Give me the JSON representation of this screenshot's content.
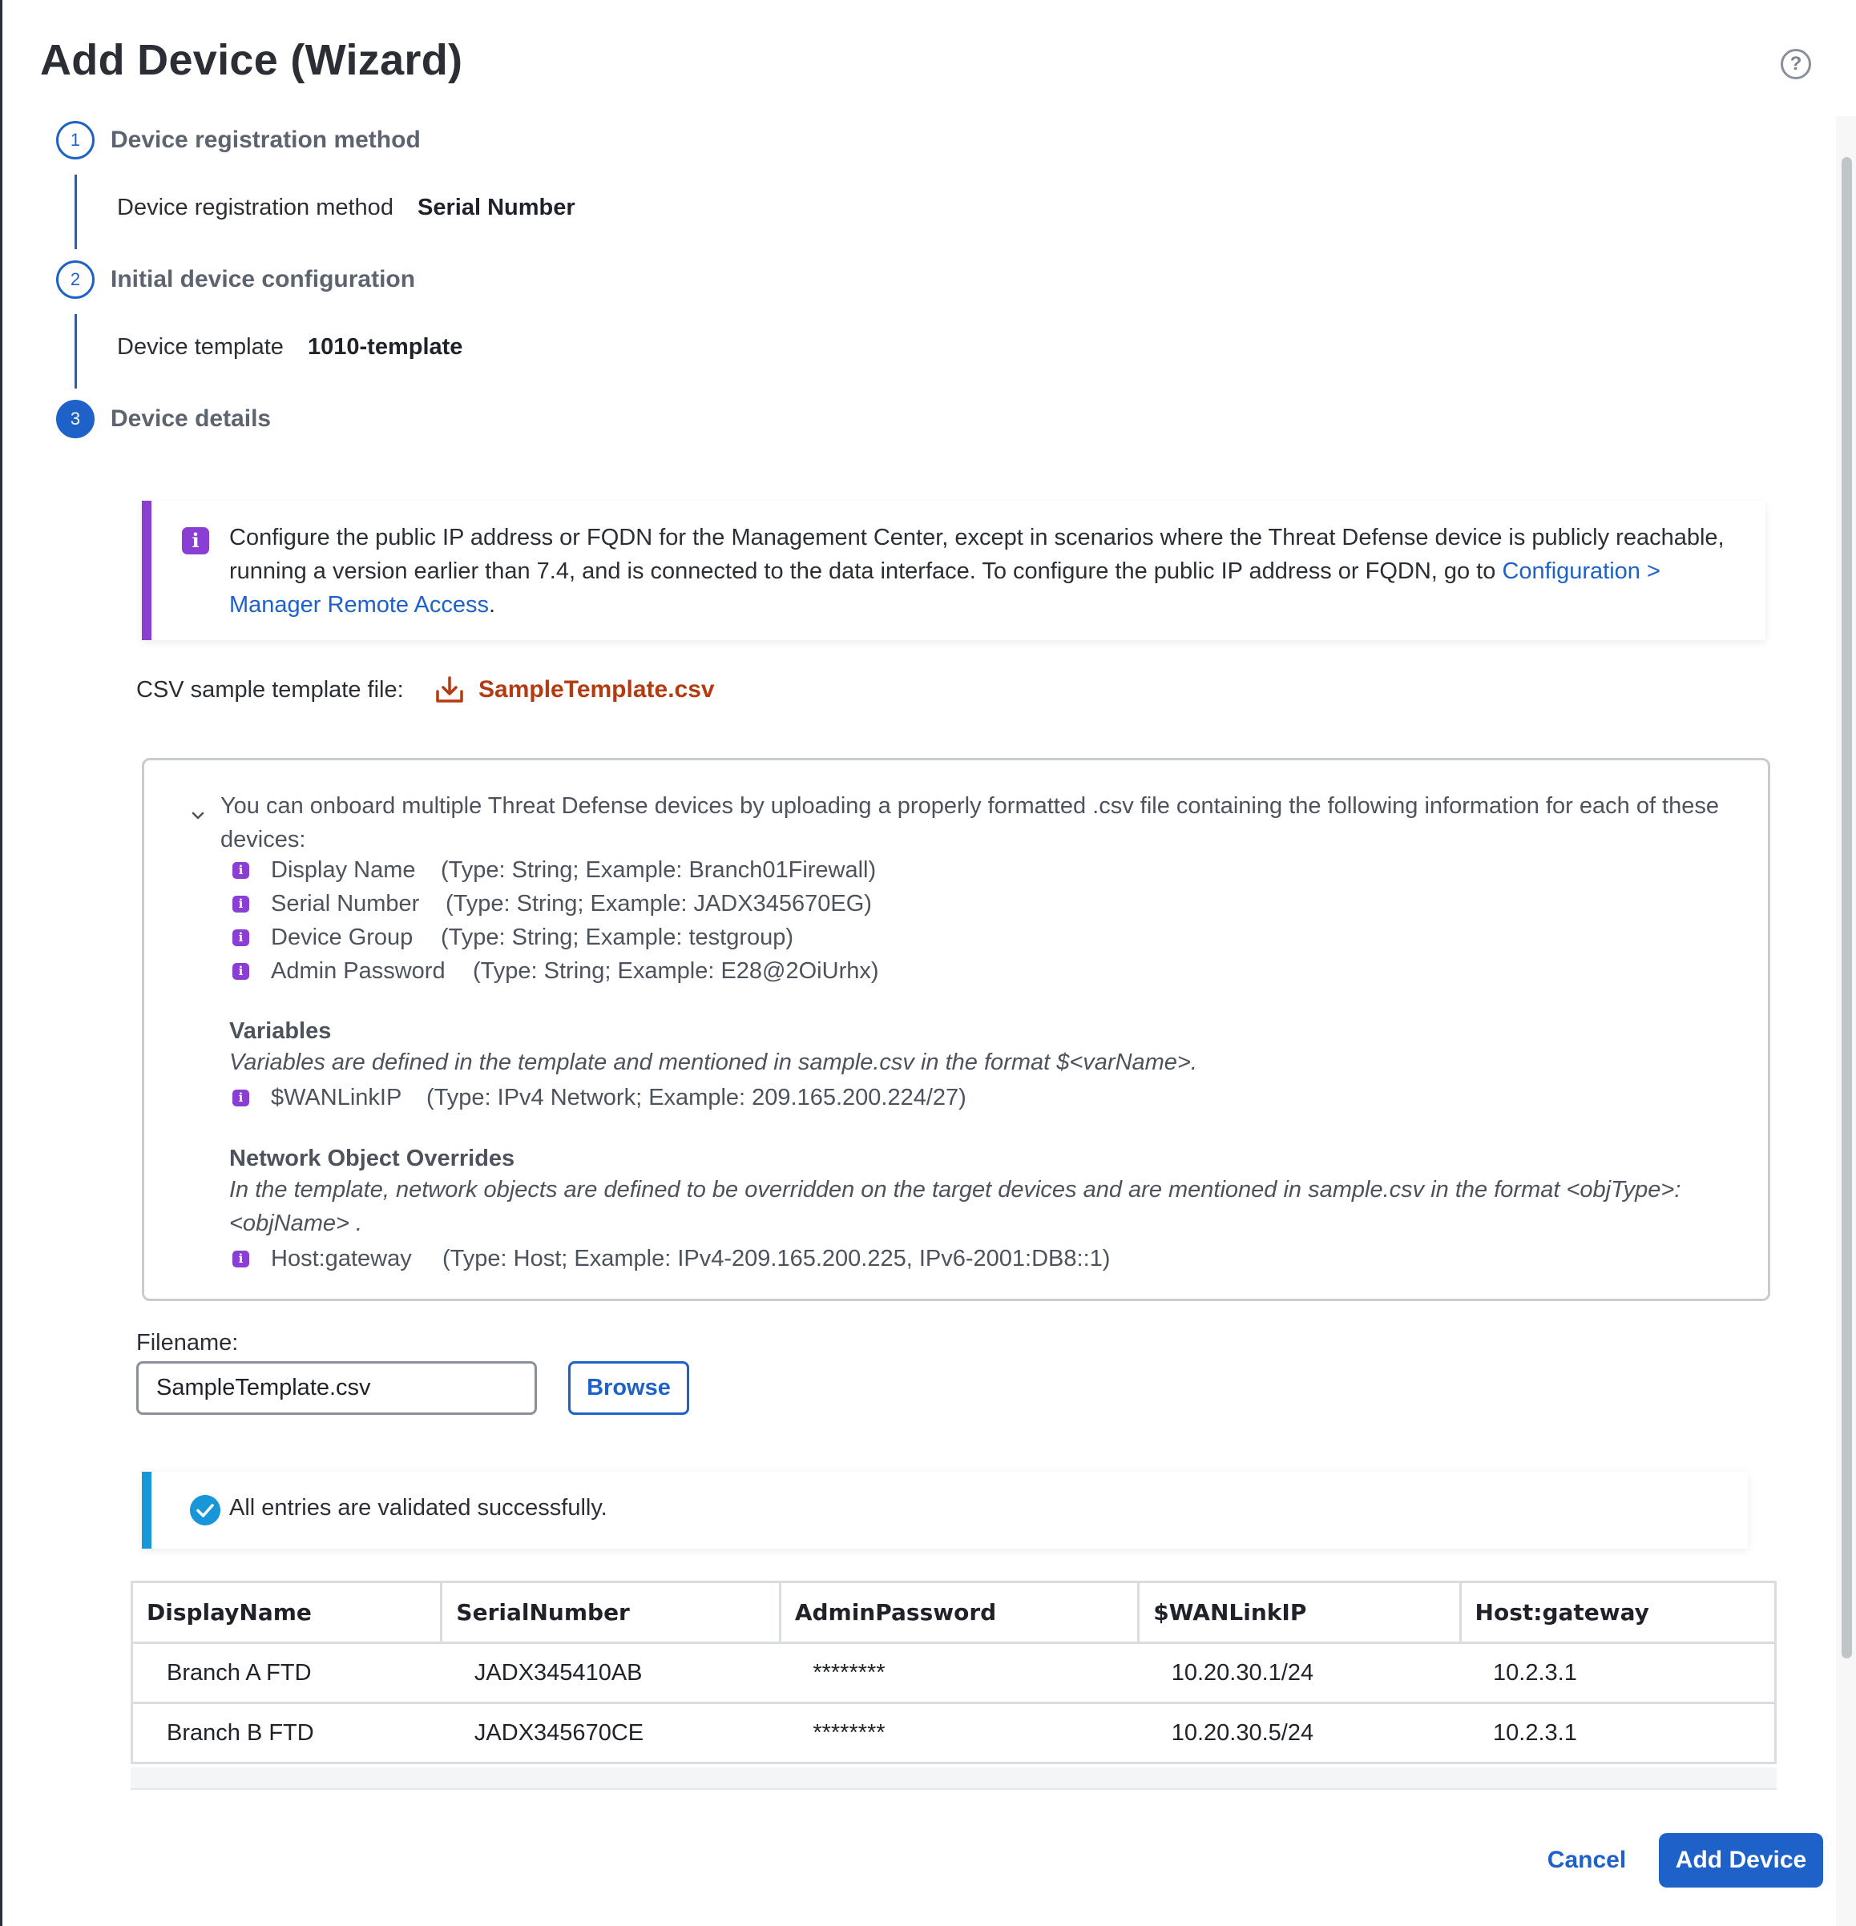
{
  "dialog": {
    "title": "Add Device (Wizard)"
  },
  "steps": [
    {
      "number": "1",
      "label": "Device registration method",
      "summary_key": "Device registration method",
      "summary_value": "Serial Number"
    },
    {
      "number": "2",
      "label": "Initial device configuration",
      "summary_key": "Device template",
      "summary_value": "1010-template"
    },
    {
      "number": "3",
      "label": "Device details"
    }
  ],
  "info_callout": {
    "text": "Configure the public IP address or FQDN for the Management Center, except in scenarios where the Threat Defense device is publicly reachable, running a version earlier than 7.4, and is connected to the data interface. To configure the public IP address or FQDN, go to",
    "link": "Configuration > Manager Remote Access",
    "suffix": "."
  },
  "csv_sample": {
    "label": "CSV sample template file:",
    "file": "SampleTemplate.csv"
  },
  "info_panel": {
    "intro": "You can onboard multiple Threat Defense devices by uploading a properly formatted .csv file containing the following information for each of these devices:",
    "fields": [
      {
        "name": "Display Name",
        "detail": "(Type: String; Example: Branch01Firewall)"
      },
      {
        "name": "Serial Number",
        "detail": "(Type: String; Example: JADX345670EG)"
      },
      {
        "name": "Device Group",
        "detail": "(Type: String; Example: testgroup)"
      },
      {
        "name": "Admin Password",
        "detail": "(Type: String; Example: E28@2OiUrhx)"
      }
    ],
    "variables": {
      "heading": "Variables",
      "note": "Variables are defined in the template and mentioned in sample.csv in the format $<varName>.",
      "items": [
        {
          "name": "$WANLinkIP",
          "detail": "(Type: IPv4 Network; Example: 209.165.200.224/27)"
        }
      ]
    },
    "overrides": {
      "heading": "Network Object Overrides",
      "note": "In the template, network objects are defined to be overridden on the target devices and are mentioned in sample.csv in the format <objType>:<objName> .",
      "items": [
        {
          "name": "Host:gateway",
          "detail": "(Type: Host; Example: IPv4-209.165.200.225, IPv6-2001:DB8::1)"
        }
      ]
    }
  },
  "filename": {
    "label": "Filename:",
    "value": "SampleTemplate.csv",
    "browse_label": "Browse"
  },
  "validation": {
    "message": "All entries are validated successfully."
  },
  "table": {
    "columns": [
      "DisplayName",
      "SerialNumber",
      "AdminPassword",
      "$WANLinkIP",
      "Host:gateway"
    ],
    "rows": [
      [
        "Branch A FTD",
        "JADX345410AB",
        "********",
        "10.20.30.1/24",
        "10.2.3.1"
      ],
      [
        "Branch B FTD",
        "JADX345670CE",
        "********",
        "10.20.30.5/24",
        "10.2.3.1"
      ]
    ]
  },
  "footer": {
    "cancel_label": "Cancel",
    "add_label": "Add Device"
  },
  "icons": {
    "help": "help-circle-icon",
    "info": "info-icon",
    "download": "download-icon",
    "chevron": "chevron-down-icon",
    "check": "check-circle-icon"
  },
  "colors": {
    "primary": "#1e62c9",
    "info_accent": "#8a3ed4",
    "success_accent": "#1797d8",
    "download_link": "#b53a0f"
  }
}
